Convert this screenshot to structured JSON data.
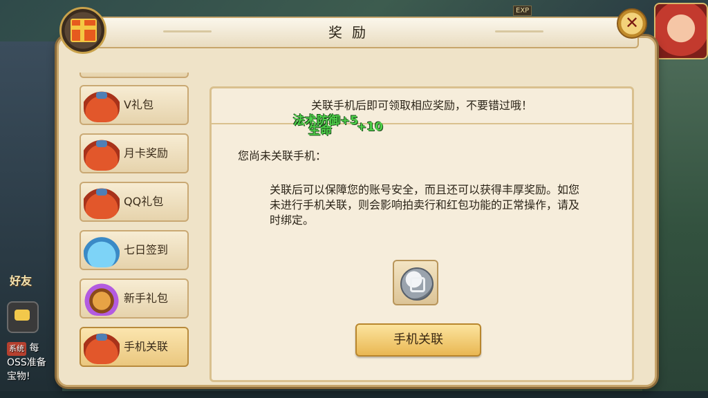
{
  "hud": {
    "friend_label": "好友",
    "chat_system_badge": "系统",
    "chat_line_1": "每",
    "chat_line_2": "OSS准备",
    "chat_line_3": "宝物!",
    "exp_label": "EXP"
  },
  "dialog": {
    "title": "奖励",
    "close_symbol": "✕"
  },
  "tabs": [
    {
      "label": "V礼包",
      "icon": "red-gift-bag-icon"
    },
    {
      "label": "月卡奖励",
      "icon": "red-gift-bag-icon"
    },
    {
      "label": "QQ礼包",
      "icon": "red-gift-bag-icon"
    },
    {
      "label": "七日签到",
      "icon": "blue-pot-icon"
    },
    {
      "label": "新手礼包",
      "icon": "golden-egg-icon"
    },
    {
      "label": "手机关联",
      "icon": "red-gift-bag-icon",
      "active": true
    }
  ],
  "content": {
    "header": "关联手机后即可领取相应奖励，不要错过哦！",
    "status": "您尚未关联手机：",
    "description": "关联后可以保障您的账号安全，而且还可以获得丰厚奖励。如您未进行手机关联，则会影响拍卖行和红包功能的正常操作，请及时绑定。",
    "reward_icon": "silver-coin-icon",
    "link_button": "手机关联"
  },
  "floating_text": {
    "line1": "法术防御+5",
    "line2": "生命",
    "line3": "+10"
  },
  "colors": {
    "panel_bg": "#efe3c8",
    "border_gold": "#c7a56b",
    "active_tab": "#eac77f",
    "float_green": "#4fd04a"
  }
}
